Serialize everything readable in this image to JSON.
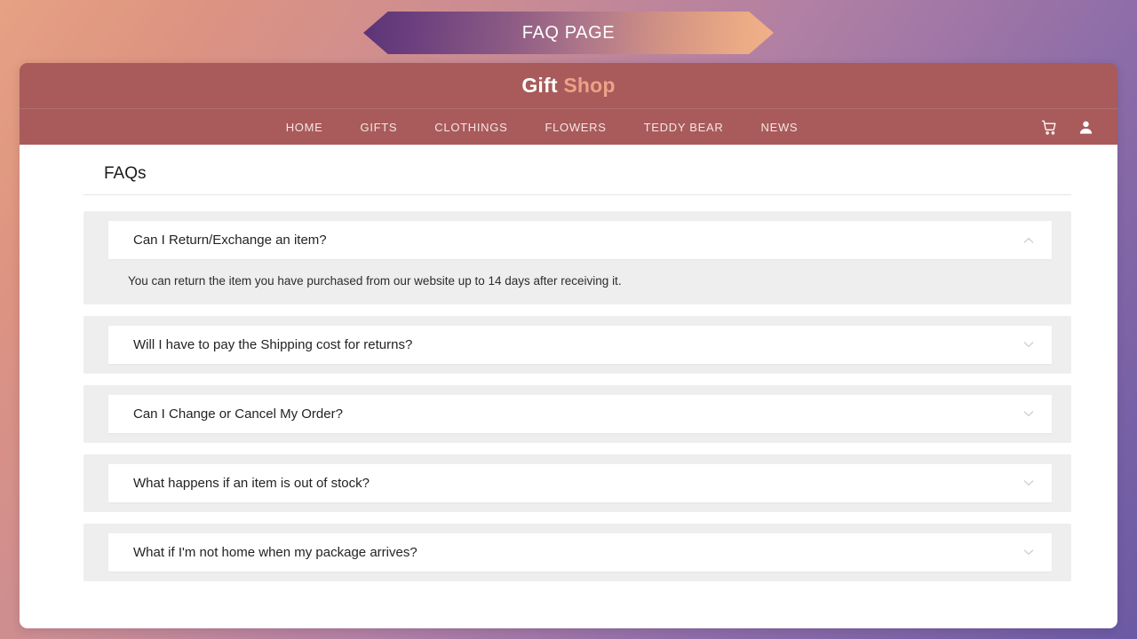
{
  "banner": {
    "title": "FAQ PAGE"
  },
  "header": {
    "brand_first": "Gift",
    "brand_second": "Shop",
    "nav_items": [
      {
        "label": "HOME"
      },
      {
        "label": "GIFTS"
      },
      {
        "label": "CLOTHINGS"
      },
      {
        "label": "FLOWERS"
      },
      {
        "label": "TEDDY BEAR"
      },
      {
        "label": "NEWS"
      }
    ],
    "icons": [
      {
        "name": "cart-icon"
      },
      {
        "name": "user-icon"
      }
    ]
  },
  "main": {
    "page_title": "FAQs",
    "faqs": [
      {
        "question": "Can I Return/Exchange an item?",
        "answer": "You can return the item you have purchased from our website up to 14 days after receiving it.",
        "expanded": true,
        "chevron": "chevron-up-icon"
      },
      {
        "question": "Will I have to pay the Shipping cost for returns?",
        "answer": "",
        "expanded": false,
        "chevron": "chevron-down-icon"
      },
      {
        "question": "Can I Change or Cancel My Order?",
        "answer": "",
        "expanded": false,
        "chevron": "chevron-down-icon"
      },
      {
        "question": "What happens if an item is out of stock?",
        "answer": "",
        "expanded": false,
        "chevron": "chevron-down-icon"
      },
      {
        "question": "What if I'm not home when my package arrives?",
        "answer": "",
        "expanded": false,
        "chevron": "chevron-down-icon"
      }
    ]
  },
  "colors": {
    "header_background": "#a95a5a",
    "brand_accent": "#eba387",
    "panel_background": "#eeeeee",
    "question_background": "#ffffff",
    "chevron": "#cfcfcf",
    "page_gradient_start": "#e6a183",
    "page_gradient_end": "#6b5aa4"
  }
}
